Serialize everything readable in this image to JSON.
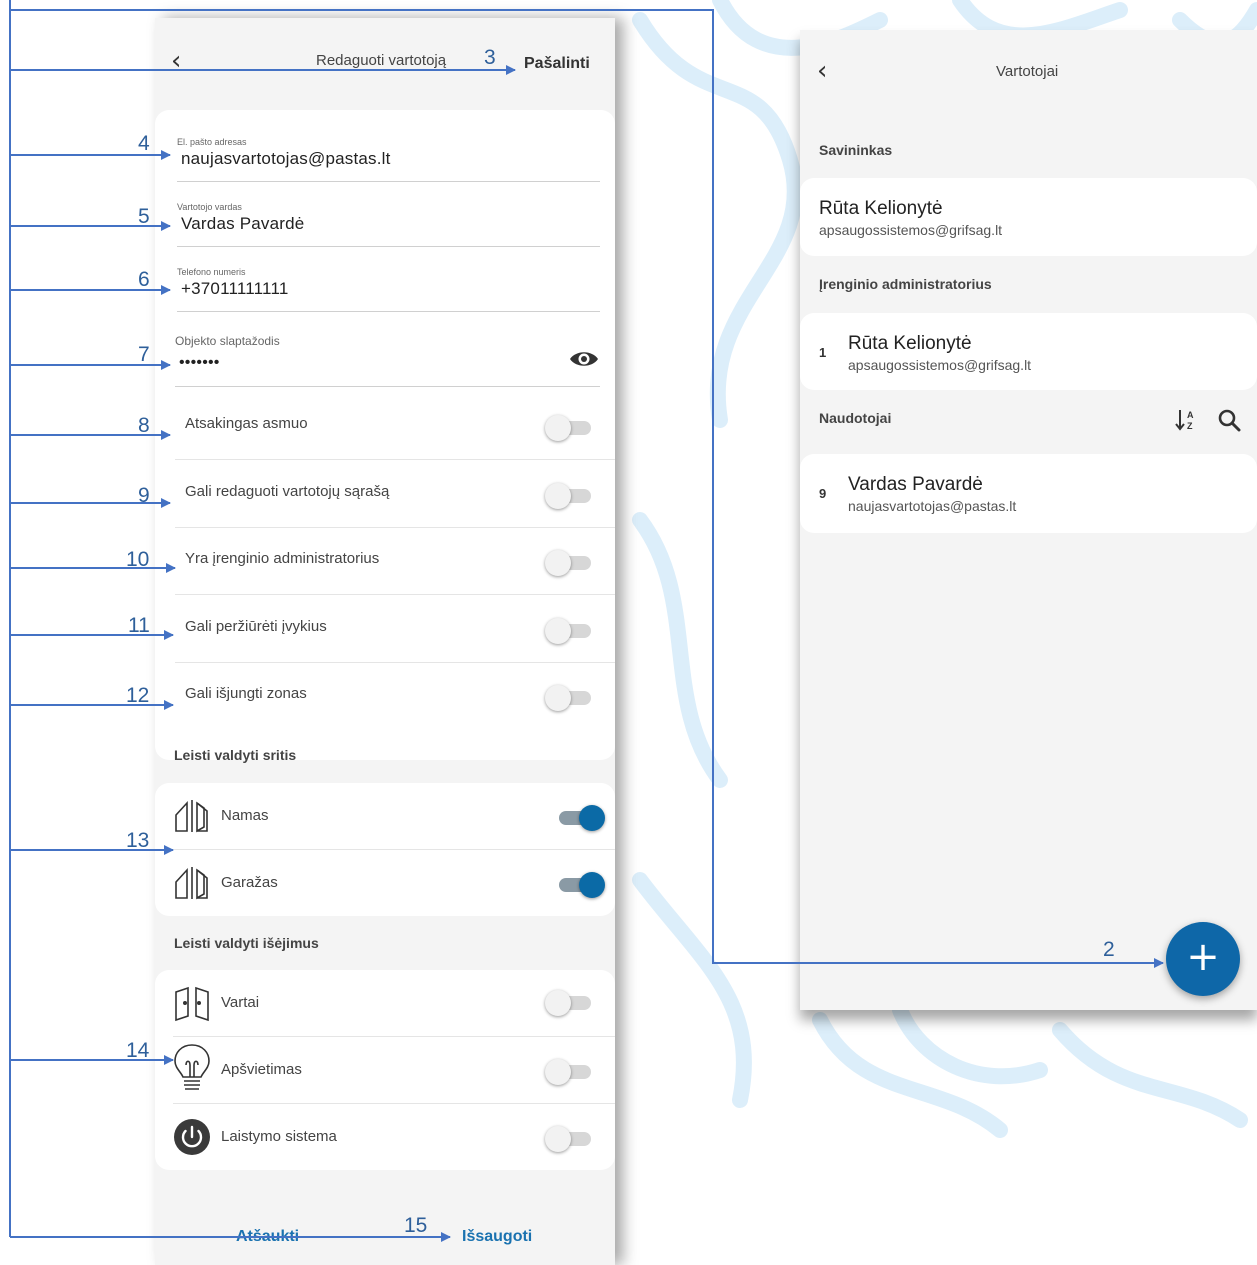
{
  "colors": {
    "accent": "#0b6aa6",
    "annotation": "#4472c4",
    "background": "#f4f4f4"
  },
  "edit_screen": {
    "back_icon": "chevron-left-icon",
    "title": "Redaguoti vartotoją",
    "delete_label": "Pašalinti",
    "fields": [
      {
        "label": "El. pašto adresas",
        "value": "naujasvartotojas@pastas.lt"
      },
      {
        "label": "Vartotojo vardas",
        "value": "Vardas Pavardė"
      },
      {
        "label": "Telefono numeris",
        "value": "+37011111111"
      },
      {
        "label": "Objekto slaptažodis",
        "value": "•••••••"
      }
    ],
    "visibility_icon": "eye-icon",
    "permissions": [
      {
        "label": "Atsakingas asmuo",
        "on": false
      },
      {
        "label": "Gali redaguoti vartotojų sąrašą",
        "on": false
      },
      {
        "label": "Yra įrenginio administratorius",
        "on": false
      },
      {
        "label": "Gali peržiūrėti įvykius",
        "on": false
      },
      {
        "label": "Gali išjungti zonas",
        "on": false
      }
    ],
    "areas_title": "Leisti valdyti sritis",
    "areas": [
      {
        "label": "Namas",
        "icon": "house-door-icon",
        "on": true
      },
      {
        "label": "Garažas",
        "icon": "house-door-icon",
        "on": true
      }
    ],
    "outputs_title": "Leisti valdyti išėjimus",
    "outputs": [
      {
        "label": "Vartai",
        "icon": "gate-icon",
        "on": false
      },
      {
        "label": "Apšvietimas",
        "icon": "lightbulb-icon",
        "on": false
      },
      {
        "label": "Laistymo sistema",
        "icon": "power-icon",
        "on": false
      }
    ],
    "cancel_label": "Atšaukti",
    "save_label": "Išsaugoti"
  },
  "users_screen": {
    "back_icon": "chevron-left-icon",
    "title": "Vartotojai",
    "owner_section": "Savininkas",
    "owner": {
      "name": "Rūta Kelionytė",
      "email": "apsaugossistemos@grifsag.lt"
    },
    "admin_section": "Įrenginio administratorius",
    "admin": {
      "number": "1",
      "name": "Rūta Kelionytė",
      "email": "apsaugossistemos@grifsag.lt"
    },
    "users_section": "Naudotojai",
    "sort_icon": "sort-alpha-icon",
    "search_icon": "search-icon",
    "user": {
      "number": "9",
      "name": "Vardas Pavardė",
      "email": "naujasvartotojas@pastas.lt"
    },
    "add_icon": "plus-icon"
  },
  "annotations": [
    "2",
    "3",
    "4",
    "5",
    "6",
    "7",
    "8",
    "9",
    "10",
    "11",
    "12",
    "13",
    "14",
    "15"
  ]
}
